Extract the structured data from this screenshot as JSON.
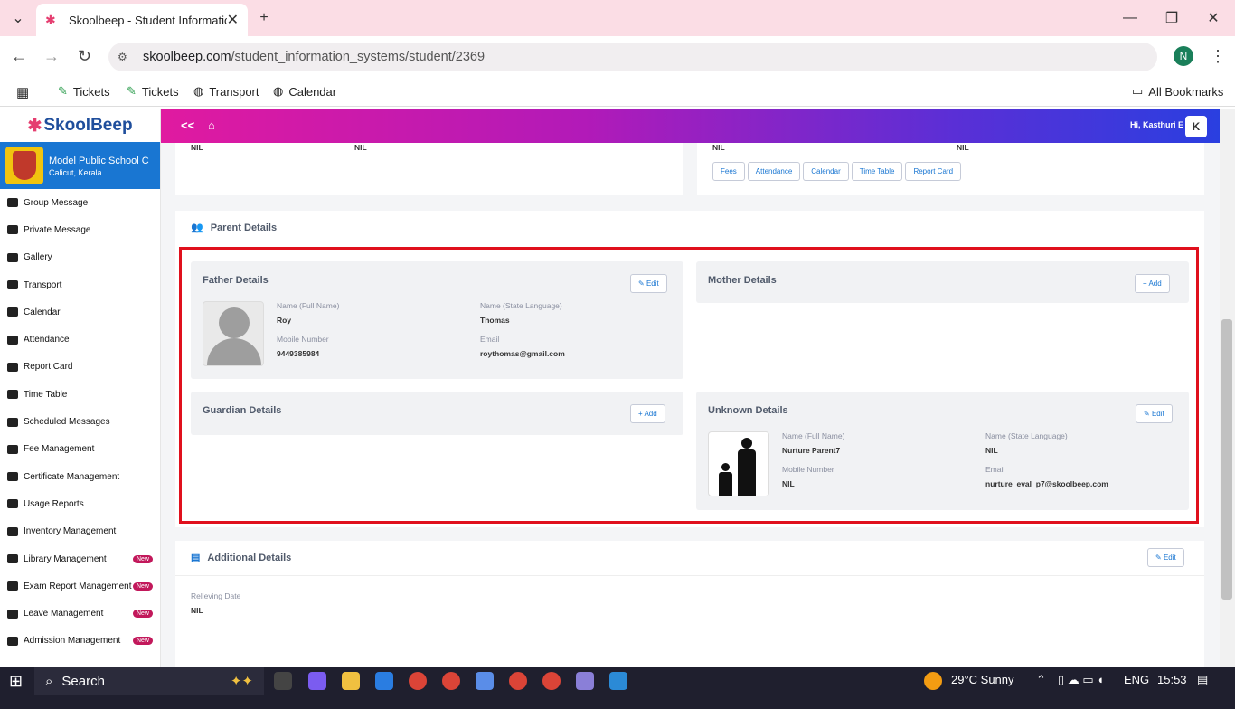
{
  "browser": {
    "tab_title": "Skoolbeep - Student Informatic",
    "url_host": "skoolbeep.com",
    "url_path": "/student_information_systems/student/2369",
    "profile_initial": "N",
    "bookmarks": [
      "Tickets",
      "Tickets",
      "Transport",
      "Calendar"
    ],
    "all_bookmarks": "All Bookmarks"
  },
  "sidebar": {
    "logo": "SkoolBeep",
    "school_name": "Model Public School C",
    "school_location": "Calicut, Kerala",
    "items": [
      {
        "label": "Group Message",
        "badge": ""
      },
      {
        "label": "Private Message",
        "badge": ""
      },
      {
        "label": "Gallery",
        "badge": ""
      },
      {
        "label": "Transport",
        "badge": ""
      },
      {
        "label": "Calendar",
        "badge": ""
      },
      {
        "label": "Attendance",
        "badge": ""
      },
      {
        "label": "Report Card",
        "badge": ""
      },
      {
        "label": "Time Table",
        "badge": ""
      },
      {
        "label": "Scheduled Messages",
        "badge": ""
      },
      {
        "label": "Fee Management",
        "badge": ""
      },
      {
        "label": "Certificate Management",
        "badge": ""
      },
      {
        "label": "Usage Reports",
        "badge": ""
      },
      {
        "label": "Inventory Management",
        "badge": ""
      },
      {
        "label": "Library Management",
        "badge": "New"
      },
      {
        "label": "Exam Report Management",
        "badge": "New"
      },
      {
        "label": "Leave Management",
        "badge": "New"
      },
      {
        "label": "Admission Management",
        "badge": "New"
      }
    ]
  },
  "topbar": {
    "collapse": "<<",
    "user": "Hi, Kasthuri E",
    "avatar": "K"
  },
  "top_cards": {
    "left_vals": [
      "NIL",
      "NIL"
    ],
    "right_vals": [
      "NIL",
      "NIL"
    ],
    "buttons": [
      "Fees",
      "Attendance",
      "Calendar",
      "Time Table",
      "Report Card"
    ]
  },
  "parent": {
    "title": "Parent Details",
    "father": {
      "title": "Father Details",
      "button": "Edit",
      "name_label": "Name (Full Name)",
      "name": "Roy",
      "state_label": "Name (State Language)",
      "state": "Thomas",
      "mobile_label": "Mobile Number",
      "mobile": "9449385984",
      "email_label": "Email",
      "email": "roythomas@gmail.com"
    },
    "mother": {
      "title": "Mother Details",
      "button": "Add"
    },
    "guardian": {
      "title": "Guardian Details",
      "button": "Add"
    },
    "unknown": {
      "title": "Unknown Details",
      "button": "Edit",
      "name_label": "Name (Full Name)",
      "name": "Nurture Parent7",
      "state_label": "Name (State Language)",
      "state": "NIL",
      "mobile_label": "Mobile Number",
      "mobile": "NIL",
      "email_label": "Email",
      "email": "nurture_eval_p7@skoolbeep.com"
    }
  },
  "additional": {
    "title": "Additional Details",
    "button": "Edit",
    "relieving_label": "Relieving Date",
    "relieving": "NIL"
  },
  "taskbar": {
    "search": "Search",
    "weather": "29°C  Sunny",
    "lang": "ENG",
    "time": "15:53"
  }
}
